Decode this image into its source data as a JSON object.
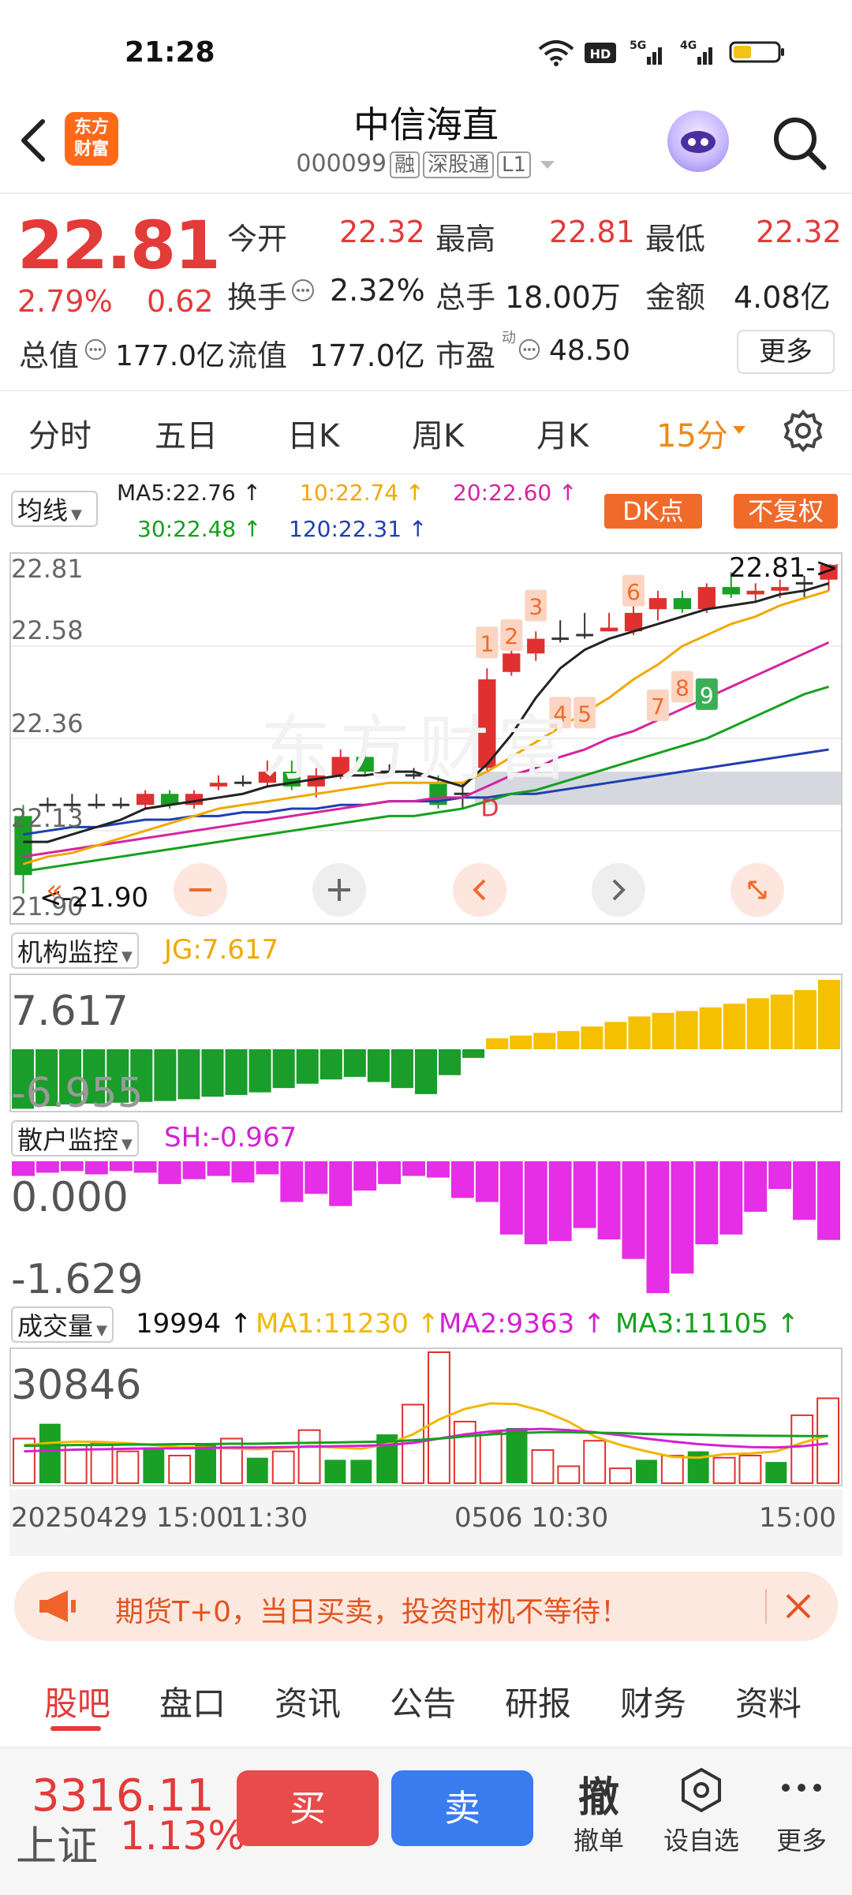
{
  "status_bar": {
    "time": "21:28"
  },
  "header": {
    "title": "中信海直",
    "code": "000099",
    "tags": [
      "融",
      "深股通",
      "L1"
    ],
    "logo_text": [
      "东方",
      "财富"
    ]
  },
  "quote": {
    "price": "22.81",
    "change_pct": "2.79%",
    "change": "0.62",
    "fields": [
      {
        "label": "今开",
        "value": "22.32",
        "color": "red"
      },
      {
        "label": "最高",
        "value": "22.81",
        "color": "red"
      },
      {
        "label": "最低",
        "value": "22.32",
        "color": "red"
      },
      {
        "label": "换手",
        "value": "2.32%",
        "color": "dark"
      },
      {
        "label": "总手",
        "value": "18.00万",
        "color": "dark"
      },
      {
        "label": "金额",
        "value": "4.08亿",
        "color": "dark"
      },
      {
        "label": "总值",
        "value": "177.0亿",
        "color": "dark"
      },
      {
        "label": "流值",
        "value": "177.0亿",
        "color": "dark"
      },
      {
        "label": "市盈",
        "value": "48.50",
        "color": "dark"
      }
    ],
    "pe_sup": "动",
    "more": "更多"
  },
  "period_tabs": [
    "分时",
    "五日",
    "日K",
    "周K",
    "月K",
    "15分"
  ],
  "ma_bar": {
    "select": "均线",
    "items": [
      {
        "text": "MA5:22.76",
        "color": "#222222"
      },
      {
        "text": "10:22.74",
        "color": "#f0a800"
      },
      {
        "text": "20:22.60",
        "color": "#d6249f"
      },
      {
        "text": "30:22.48",
        "color": "#16a01e"
      },
      {
        "text": "120:22.31",
        "color": "#1f3fb0"
      }
    ],
    "dk": "DK点",
    "fq": "不复权"
  },
  "kline": {
    "y_labels": [
      "22.81",
      "22.58",
      "22.36",
      "22.13",
      "21.90"
    ],
    "last_label": "22.81",
    "low_label": "21.90",
    "watermark": "东方财富",
    "markers": [
      "1",
      "2",
      "3",
      "4",
      "5",
      "6",
      "7",
      "8",
      "9"
    ],
    "d_marker": "D"
  },
  "jg": {
    "select": "机构监控",
    "value_label": "JG:7.617",
    "max": "7.617",
    "min": "-6.955"
  },
  "sh": {
    "select": "散户监控",
    "value_label": "SH:-0.967",
    "max": "0.000",
    "min": "-1.629"
  },
  "vol": {
    "select": "成交量",
    "last": "19994",
    "ma1": "MA1:11230",
    "ma2": "MA2:9363",
    "ma3": "MA3:11105",
    "max": "30846"
  },
  "time_axis": {
    "t1": "20250429 15:00",
    "t2": "11:30",
    "t3": "0506 10:30",
    "t4": "15:00"
  },
  "banner": {
    "text": "期货T+0，当日买卖，投资时机不等待！"
  },
  "bottom_tabs": [
    "股吧",
    "盘口",
    "资讯",
    "公告",
    "研报",
    "财务",
    "资料"
  ],
  "bottom_bar": {
    "index_value": "3316.11",
    "index_name": "上证",
    "index_pct": "1.13%",
    "buy": "买",
    "sell": "卖",
    "cancel_icon": "撤",
    "cancel": "撤单",
    "watch": "设自选",
    "more": "更多"
  },
  "chart_data": {
    "type": "candlestick",
    "ylim": [
      21.9,
      22.81
    ],
    "candles": [
      {
        "o": 22.13,
        "c": 21.97,
        "h": 22.16,
        "l": 21.92
      },
      {
        "o": 22.16,
        "c": 22.16,
        "h": 22.18,
        "l": 22.14
      },
      {
        "o": 22.16,
        "c": 22.16,
        "h": 22.19,
        "l": 22.14
      },
      {
        "o": 22.16,
        "c": 22.16,
        "h": 22.19,
        "l": 22.15
      },
      {
        "o": 22.16,
        "c": 22.16,
        "h": 22.18,
        "l": 22.15
      },
      {
        "o": 22.16,
        "c": 22.19,
        "h": 22.2,
        "l": 22.15
      },
      {
        "o": 22.19,
        "c": 22.16,
        "h": 22.2,
        "l": 22.15
      },
      {
        "o": 22.16,
        "c": 22.19,
        "h": 22.2,
        "l": 22.15
      },
      {
        "o": 22.21,
        "c": 22.22,
        "h": 22.24,
        "l": 22.2
      },
      {
        "o": 22.22,
        "c": 22.22,
        "h": 22.24,
        "l": 22.21
      },
      {
        "o": 22.22,
        "c": 22.25,
        "h": 22.28,
        "l": 22.21
      },
      {
        "o": 22.25,
        "c": 22.21,
        "h": 22.28,
        "l": 22.2
      },
      {
        "o": 22.21,
        "c": 22.24,
        "h": 22.26,
        "l": 22.18
      },
      {
        "o": 22.24,
        "c": 22.29,
        "h": 22.31,
        "l": 22.23
      },
      {
        "o": 22.29,
        "c": 22.25,
        "h": 22.31,
        "l": 22.24
      },
      {
        "o": 22.25,
        "c": 22.25,
        "h": 22.27,
        "l": 22.24
      },
      {
        "o": 22.24,
        "c": 22.24,
        "h": 22.26,
        "l": 22.23
      },
      {
        "o": 22.22,
        "c": 22.16,
        "h": 22.24,
        "l": 22.15
      },
      {
        "o": 22.19,
        "c": 22.19,
        "h": 22.22,
        "l": 22.15
      },
      {
        "o": 22.26,
        "c": 22.5,
        "h": 22.53,
        "l": 22.25
      },
      {
        "o": 22.52,
        "c": 22.57,
        "h": 22.59,
        "l": 22.51
      },
      {
        "o": 22.57,
        "c": 22.61,
        "h": 22.63,
        "l": 22.55
      },
      {
        "o": 22.61,
        "c": 22.61,
        "h": 22.66,
        "l": 22.6
      },
      {
        "o": 22.62,
        "c": 22.62,
        "h": 22.68,
        "l": 22.61
      },
      {
        "o": 22.63,
        "c": 22.64,
        "h": 22.68,
        "l": 22.63
      },
      {
        "o": 22.63,
        "c": 22.68,
        "h": 22.77,
        "l": 22.62
      },
      {
        "o": 22.69,
        "c": 22.72,
        "h": 22.74,
        "l": 22.66
      },
      {
        "o": 22.72,
        "c": 22.69,
        "h": 22.74,
        "l": 22.68
      },
      {
        "o": 22.69,
        "c": 22.75,
        "h": 22.76,
        "l": 22.68
      },
      {
        "o": 22.75,
        "c": 22.73,
        "h": 22.79,
        "l": 22.72
      },
      {
        "o": 22.73,
        "c": 22.74,
        "h": 22.76,
        "l": 22.71
      },
      {
        "o": 22.74,
        "c": 22.75,
        "h": 22.77,
        "l": 22.72
      },
      {
        "o": 22.76,
        "c": 22.76,
        "h": 22.78,
        "l": 22.72
      },
      {
        "o": 22.77,
        "c": 22.81,
        "h": 22.81,
        "l": 22.74
      }
    ],
    "ma5": [
      22.06,
      22.06,
      22.08,
      22.1,
      22.12,
      22.15,
      22.16,
      22.17,
      22.18,
      22.19,
      22.21,
      22.22,
      22.23,
      22.24,
      22.24,
      22.25,
      22.25,
      22.23,
      22.21,
      22.27,
      22.35,
      22.45,
      22.53,
      22.58,
      22.61,
      22.63,
      22.65,
      22.67,
      22.69,
      22.7,
      22.71,
      22.73,
      22.74,
      22.76
    ],
    "ma10": [
      22.0,
      22.02,
      22.03,
      22.05,
      22.07,
      22.09,
      22.11,
      22.13,
      22.15,
      22.16,
      22.17,
      22.18,
      22.19,
      22.2,
      22.21,
      22.22,
      22.22,
      22.22,
      22.22,
      22.25,
      22.29,
      22.33,
      22.37,
      22.41,
      22.45,
      22.5,
      22.54,
      22.59,
      22.62,
      22.65,
      22.67,
      22.7,
      22.72,
      22.74
    ],
    "ma20": [
      22.02,
      22.03,
      22.04,
      22.05,
      22.06,
      22.07,
      22.08,
      22.09,
      22.1,
      22.11,
      22.12,
      22.13,
      22.14,
      22.15,
      22.16,
      22.17,
      22.17,
      22.18,
      22.18,
      22.21,
      22.24,
      22.26,
      22.29,
      22.31,
      22.34,
      22.36,
      22.39,
      22.42,
      22.45,
      22.48,
      22.51,
      22.54,
      22.57,
      22.6
    ],
    "ma30": [
      21.98,
      21.99,
      22.0,
      22.01,
      22.02,
      22.03,
      22.04,
      22.05,
      22.06,
      22.07,
      22.08,
      22.09,
      22.1,
      22.11,
      22.12,
      22.13,
      22.13,
      22.14,
      22.15,
      22.17,
      22.19,
      22.2,
      22.22,
      22.24,
      22.26,
      22.28,
      22.3,
      22.32,
      22.34,
      22.37,
      22.4,
      22.43,
      22.46,
      22.48
    ],
    "ma120": [
      22.08,
      22.09,
      22.1,
      22.1,
      22.11,
      22.12,
      22.12,
      22.13,
      22.13,
      22.14,
      22.14,
      22.15,
      22.15,
      22.16,
      22.16,
      22.17,
      22.17,
      22.17,
      22.18,
      22.18,
      22.19,
      22.19,
      22.2,
      22.21,
      22.22,
      22.23,
      22.24,
      22.25,
      22.26,
      22.27,
      22.28,
      22.29,
      22.3,
      22.31
    ],
    "jg_values": [
      -6.9,
      -6.6,
      -6.4,
      -6.3,
      -6.2,
      -6.1,
      -6.0,
      -5.8,
      -5.5,
      -5.3,
      -5.0,
      -4.5,
      -4.0,
      -3.5,
      -3.2,
      -3.8,
      -4.5,
      -5.2,
      -3.0,
      -1.0,
      1.2,
      1.5,
      1.8,
      2.0,
      2.5,
      3.0,
      3.6,
      4.0,
      4.2,
      4.6,
      5.0,
      5.6,
      6.0,
      6.5,
      7.617
    ],
    "sh_values": [
      -0.18,
      -0.14,
      -0.12,
      -0.16,
      -0.12,
      -0.14,
      -0.28,
      -0.22,
      -0.18,
      -0.26,
      -0.16,
      -0.5,
      -0.4,
      -0.55,
      -0.36,
      -0.28,
      -0.18,
      -0.2,
      -0.45,
      -0.5,
      -0.9,
      -1.02,
      -0.98,
      -0.82,
      -0.96,
      -1.2,
      -1.62,
      -1.38,
      -1.02,
      -0.9,
      -0.62,
      -0.34,
      -0.72,
      -0.967
    ],
    "volume": [
      {
        "v": 10500,
        "up": false
      },
      {
        "v": 14000,
        "up": true
      },
      {
        "v": 9000,
        "up": false
      },
      {
        "v": 9500,
        "up": false
      },
      {
        "v": 7500,
        "up": false
      },
      {
        "v": 8000,
        "up": true
      },
      {
        "v": 6500,
        "up": false
      },
      {
        "v": 9000,
        "up": true
      },
      {
        "v": 10500,
        "up": false
      },
      {
        "v": 6000,
        "up": true
      },
      {
        "v": 7500,
        "up": false
      },
      {
        "v": 12500,
        "up": false
      },
      {
        "v": 5500,
        "up": true
      },
      {
        "v": 5500,
        "up": true
      },
      {
        "v": 11500,
        "up": true
      },
      {
        "v": 18500,
        "up": false
      },
      {
        "v": 30846,
        "up": false
      },
      {
        "v": 14500,
        "up": false
      },
      {
        "v": 12000,
        "up": false
      },
      {
        "v": 13000,
        "up": true
      },
      {
        "v": 7800,
        "up": false
      },
      {
        "v": 4000,
        "up": false
      },
      {
        "v": 10000,
        "up": false
      },
      {
        "v": 3500,
        "up": false
      },
      {
        "v": 5500,
        "up": true
      },
      {
        "v": 6500,
        "up": false
      },
      {
        "v": 7500,
        "up": true
      },
      {
        "v": 6000,
        "up": false
      },
      {
        "v": 6500,
        "up": false
      },
      {
        "v": 5000,
        "up": true
      },
      {
        "v": 16000,
        "up": false
      },
      {
        "v": 19994,
        "up": false
      }
    ],
    "vol_ma1": [
      9000,
      9500,
      9800,
      9700,
      9400,
      9000,
      8500,
      8400,
      8200,
      8000,
      8300,
      8700,
      8400,
      8100,
      9200,
      11500,
      15000,
      17500,
      18800,
      18600,
      17000,
      14500,
      11000,
      9000,
      7500,
      6200,
      6000,
      6800,
      7000,
      7500,
      9500,
      11230
    ],
    "vol_ma2": [
      7500,
      7700,
      7900,
      8000,
      8100,
      8200,
      8200,
      8300,
      8400,
      8400,
      8500,
      8600,
      8700,
      8800,
      9000,
      9500,
      10500,
      11500,
      12200,
      12600,
      12800,
      12500,
      12000,
      11300,
      10500,
      9800,
      9200,
      8800,
      8500,
      8400,
      8700,
      9363
    ],
    "vol_ma3": [
      8800,
      8900,
      9000,
      9000,
      9100,
      9100,
      9200,
      9200,
      9300,
      9300,
      9400,
      9500,
      9600,
      9700,
      9800,
      10100,
      10500,
      11000,
      11500,
      11800,
      12000,
      12000,
      11900,
      11800,
      11600,
      11500,
      11400,
      11300,
      11200,
      11150,
      11100,
      11105
    ]
  }
}
